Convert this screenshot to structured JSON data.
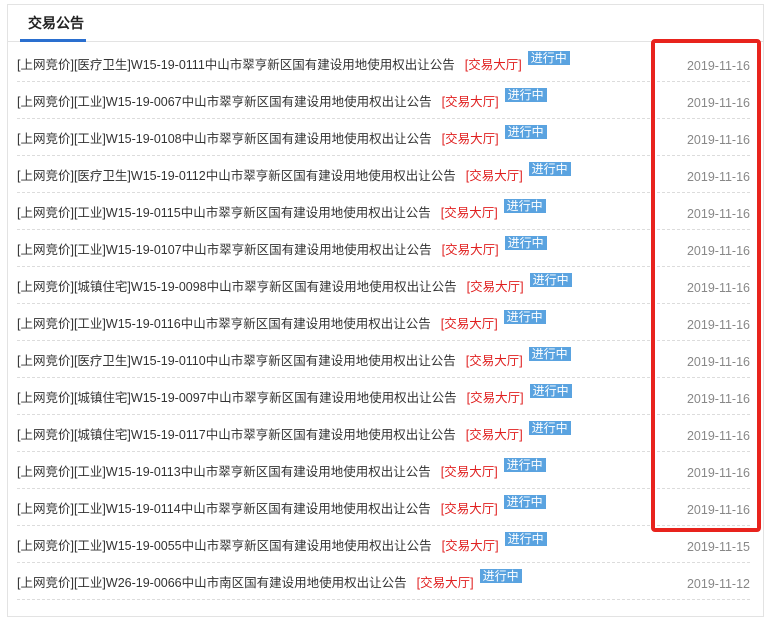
{
  "panel": {
    "title": "交易公告"
  },
  "notices": [
    {
      "title": "[上网竞价][医疗卫生]W15-19-0111中山市翠亨新区国有建设用地使用权出让公告",
      "hall": "[交易大厅]",
      "status": "进行中",
      "date": "2019-11-16"
    },
    {
      "title": "[上网竞价][工业]W15-19-0067中山市翠亨新区国有建设用地使用权出让公告",
      "hall": "[交易大厅]",
      "status": "进行中",
      "date": "2019-11-16"
    },
    {
      "title": "[上网竞价][工业]W15-19-0108中山市翠亨新区国有建设用地使用权出让公告",
      "hall": "[交易大厅]",
      "status": "进行中",
      "date": "2019-11-16"
    },
    {
      "title": "[上网竞价][医疗卫生]W15-19-0112中山市翠亨新区国有建设用地使用权出让公告",
      "hall": "[交易大厅]",
      "status": "进行中",
      "date": "2019-11-16"
    },
    {
      "title": "[上网竞价][工业]W15-19-0115中山市翠亨新区国有建设用地使用权出让公告",
      "hall": "[交易大厅]",
      "status": "进行中",
      "date": "2019-11-16"
    },
    {
      "title": "[上网竞价][工业]W15-19-0107中山市翠亨新区国有建设用地使用权出让公告",
      "hall": "[交易大厅]",
      "status": "进行中",
      "date": "2019-11-16"
    },
    {
      "title": "[上网竞价][城镇住宅]W15-19-0098中山市翠亨新区国有建设用地使用权出让公告",
      "hall": "[交易大厅]",
      "status": "进行中",
      "date": "2019-11-16"
    },
    {
      "title": "[上网竞价][工业]W15-19-0116中山市翠亨新区国有建设用地使用权出让公告",
      "hall": "[交易大厅]",
      "status": "进行中",
      "date": "2019-11-16"
    },
    {
      "title": "[上网竞价][医疗卫生]W15-19-0110中山市翠亨新区国有建设用地使用权出让公告",
      "hall": "[交易大厅]",
      "status": "进行中",
      "date": "2019-11-16"
    },
    {
      "title": "[上网竞价][城镇住宅]W15-19-0097中山市翠亨新区国有建设用地使用权出让公告",
      "hall": "[交易大厅]",
      "status": "进行中",
      "date": "2019-11-16"
    },
    {
      "title": "[上网竞价][城镇住宅]W15-19-0117中山市翠亨新区国有建设用地使用权出让公告",
      "hall": "[交易大厅]",
      "status": "进行中",
      "date": "2019-11-16"
    },
    {
      "title": "[上网竞价][工业]W15-19-0113中山市翠亨新区国有建设用地使用权出让公告",
      "hall": "[交易大厅]",
      "status": "进行中",
      "date": "2019-11-16"
    },
    {
      "title": "[上网竞价][工业]W15-19-0114中山市翠亨新区国有建设用地使用权出让公告",
      "hall": "[交易大厅]",
      "status": "进行中",
      "date": "2019-11-16"
    },
    {
      "title": "[上网竞价][工业]W15-19-0055中山市翠亨新区国有建设用地使用权出让公告",
      "hall": "[交易大厅]",
      "status": "进行中",
      "date": "2019-11-15"
    },
    {
      "title": "[上网竞价][工业]W26-19-0066中山市南区国有建设用地使用权出让公告",
      "hall": "[交易大厅]",
      "status": "进行中",
      "date": "2019-11-12"
    }
  ],
  "colors": {
    "accent": "#2a6fcf",
    "hall_red": "#e02020",
    "badge_blue": "#5aa3e0",
    "annotation_red": "#e8231d"
  }
}
